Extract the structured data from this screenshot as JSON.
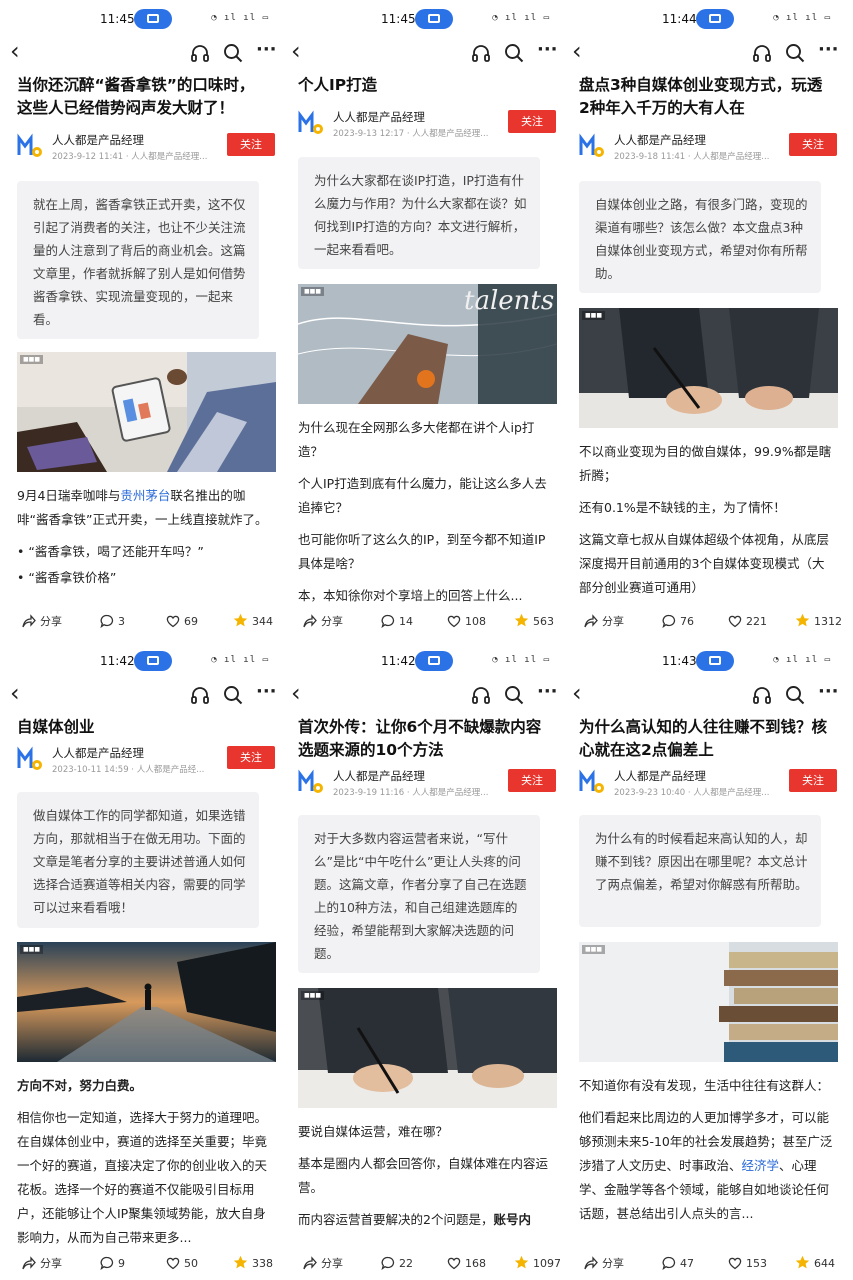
{
  "common": {
    "author_name": "人人都是产品经理",
    "follow_label": "关注",
    "share_label": "分享",
    "more_glyph": "···",
    "back_glyph": "‹",
    "accent_color": "#e8352e",
    "link_color": "#2a6ad8"
  },
  "panels": [
    {
      "time": "11:45",
      "title": "当你还沉醉“酱香拿铁”的口味时，这些人已经借势闷声发大财了！",
      "meta": "2023-9-12 11:41 · 人人都是产品经理...",
      "summary": "就在上周，酱香拿铁正式开卖，这不仅引起了消费者的关注，也让不少关注流量的人注意到了背后的商业机会。这篇文章里，作者就拆解了别人是如何借势酱香拿铁、实现流量变现的，一起来看。",
      "body": {
        "p1_a": "9月4日瑞幸咖啡与",
        "p1_link": "贵州茅台",
        "p1_b": "联名推出的咖啡“酱香拿铁”正式开卖，一上线直接就炸了。",
        "bullet1": "“酱香拿铁，喝了还能开车吗？”",
        "bullet2": "“酱香拿铁价格”"
      },
      "comments": "3",
      "likes": "69",
      "favs": "344"
    },
    {
      "time": "11:45",
      "title": "个人IP打造",
      "meta": "2023-9-13 12:17 · 人人都是产品经理...",
      "summary": "为什么大家都在谈IP打造，IP打造有什么魔力与作用？为什么大家都在谈？如何找到IP打造的方向？本文进行解析，一起来看看吧。",
      "image_text": "talents",
      "body": {
        "p1": "为什么现在全网那么多大佬都在讲个人ip打造？",
        "p2": "个人IP打造到底有什么魔力，能让这么多人去追捧它？",
        "p3": "也可能你听了这么久的IP，到至今都不知道IP具体是啥？",
        "p4": "本，本知徐你对个享培上的回答上什么..."
      },
      "comments": "14",
      "likes": "108",
      "favs": "563"
    },
    {
      "time": "11:44",
      "title": "盘点3种自媒体创业变现方式，玩透2种年入千万的大有人在",
      "meta": "2023-9-18 11:41 · 人人都是产品经理...",
      "summary": "自媒体创业之路，有很多门路，变现的渠道有哪些？该怎么做？本文盘点3种自媒体创业变现方式，希望对你有所帮助。",
      "body": {
        "p1": "不以商业变现为目的做自媒体，99.9%都是瞎折腾；",
        "p2": "还有0.1%是不缺钱的主，为了情怀！",
        "p3": "这篇文章七叔从自媒体超级个体视角，从底层深度揭开目前通用的3个自媒体变现模式（大部分创业赛道可通用）"
      },
      "comments": "76",
      "likes": "221",
      "favs": "1312"
    },
    {
      "time": "11:42",
      "title": "自媒体创业",
      "meta": "2023-10-11 14:59 · 人人都是产品经...",
      "summary": "做自媒体工作的同学都知道，如果选错方向，那就相当于在做无用功。下面的文章是笔者分享的主要讲述普通人如何选择合适赛道等相关内容，需要的同学可以过来看看哦！",
      "body": {
        "p1": "方向不对，努力白费。",
        "p2": "相信你也一定知道，选择大于努力的道理吧。在自媒体创业中，赛道的选择至关重要；毕竟一个好的赛道，直接决定了你的创业收入的天花板。选择一个好的赛道不仅能吸引目标用户，还能够让个人IP聚集领域势能，放大自身影响力，从而为自己带来更多..."
      },
      "comments": "9",
      "likes": "50",
      "favs": "338"
    },
    {
      "time": "11:42",
      "title": "首次外传：让你6个月不缺爆款内容选题来源的10个方法",
      "meta": "2023-9-19 11:16 · 人人都是产品经理...",
      "summary": "对于大多数内容运营者来说，“写什么”是比“中午吃什么”更让人头疼的问题。这篇文章，作者分享了自己在选题上的10种方法，和自己组建选题库的经验，希望能帮到大家解决选题的问题。",
      "body": {
        "p1": "要说自媒体运营，难在哪？",
        "p2": "基本是圈内人都会回答你，自媒体难在内容运营。",
        "p3_a": "而内容运营首要解决的2个问题是，",
        "p3_b": "账号内"
      },
      "comments": "22",
      "likes": "168",
      "favs": "1097"
    },
    {
      "time": "11:43",
      "title": "为什么高认知的人往往赚不到钱？核心就在这2点偏差上",
      "meta": "2023-9-23 10:40 · 人人都是产品经理...",
      "summary": "为什么有的时候看起来高认知的人，却赚不到钱？原因出在哪里呢？本文总计了两点偏差，希望对你解惑有所帮助。",
      "body": {
        "p1": "不知道你有没有发现，生活中往往有这群人：",
        "p2_a": "他们看起来比周边的人更加博学多才，可以能够预测未来5-10年的社会发展趋势；甚至广泛涉猎了人文历史、时事政治、",
        "p2_link": "经济学",
        "p2_b": "、心理学、金融学等各个领域，能够自如地谈论任何话题，甚总结出引人点头的言..."
      },
      "comments": "47",
      "likes": "153",
      "favs": "644"
    }
  ]
}
